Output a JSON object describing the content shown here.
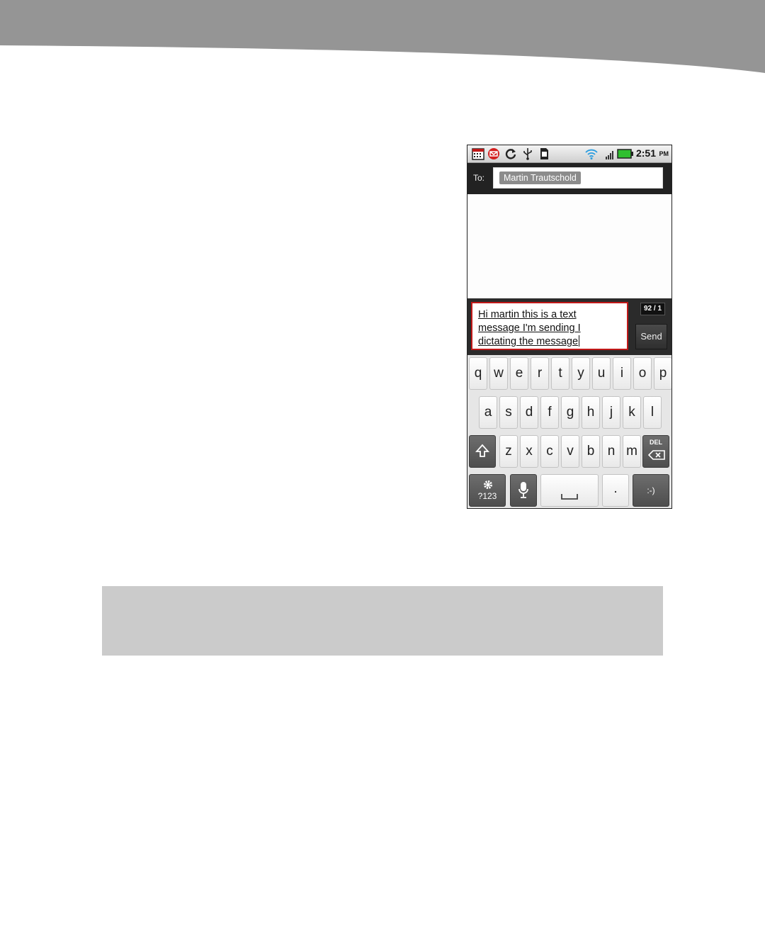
{
  "colors": {
    "banner": "#959595",
    "compose_border": "#c01818",
    "recipient_chip": "#8c8c8c",
    "battery": "#2fbf2f",
    "notification_red": "#d42020",
    "caption_box": "#cbcbcb"
  },
  "status_bar": {
    "time": "2:51",
    "ampm": "PM",
    "left_icons": [
      "calendar-icon",
      "email-notification-icon",
      "sync-icon",
      "usb-icon",
      "sd-card-icon"
    ],
    "right_icons": [
      "wifi-icon",
      "signal-icon",
      "battery-icon"
    ]
  },
  "recipient": {
    "to_label": "To:",
    "name": "Martin Trautschold"
  },
  "compose": {
    "lines": [
      "Hi martin this is a text",
      "message I'm sending I",
      "dictating the message"
    ],
    "counter": "92 / 1",
    "send_label": "Send"
  },
  "keyboard": {
    "row1": [
      "q",
      "w",
      "e",
      "r",
      "t",
      "y",
      "u",
      "i",
      "o",
      "p"
    ],
    "row2": [
      "a",
      "s",
      "d",
      "f",
      "g",
      "h",
      "j",
      "k",
      "l"
    ],
    "row3": [
      "z",
      "x",
      "c",
      "v",
      "b",
      "n",
      "m"
    ],
    "shift_icon": "shift-icon",
    "delete_label": "DEL",
    "delete_icon": "backspace-icon",
    "symbols_label": "?123",
    "settings_icon": "gear-icon",
    "mic_icon": "microphone-icon",
    "space_icon": "space-bar-icon",
    "period_label": ".",
    "smiley_label": ":-)"
  }
}
